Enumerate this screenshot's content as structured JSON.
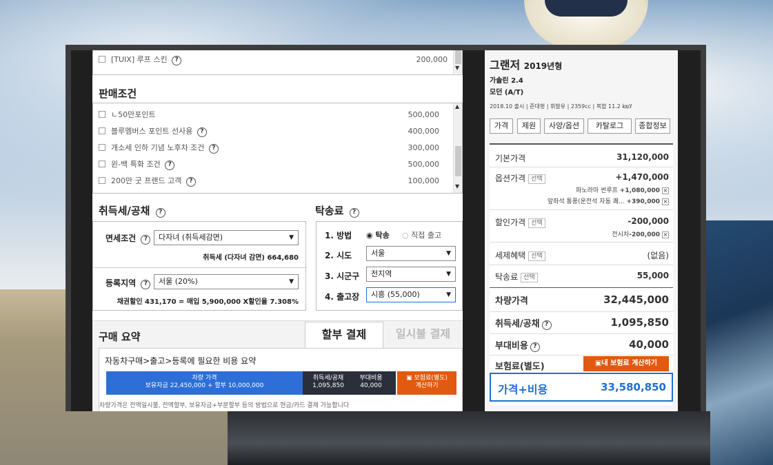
{
  "options_top": {
    "label": "[TUIX] 루프 스킨",
    "price": "200,000"
  },
  "sales": {
    "title": "판매조건",
    "items": [
      {
        "label": "ㄴ50만포인트",
        "price": "500,000",
        "q": false
      },
      {
        "label": "블루멤버스 포인트 선사용",
        "price": "400,000",
        "q": true
      },
      {
        "label": "개소세 인하 기념 노후차 조건",
        "price": "300,000",
        "q": true
      },
      {
        "label": "윈-백 특화 조건",
        "price": "500,000",
        "q": true
      },
      {
        "label": "200만 굿 프랜드 고객",
        "price": "100,000",
        "q": true
      }
    ]
  },
  "tax": {
    "title": "취득세/공채",
    "q": "?",
    "exempt_label": "면세조건",
    "exempt_value": "다자녀 (취득세감면)",
    "tax_text": "취득세 (다자녀 감면) 664,680",
    "region_label": "등록지역",
    "region_value": "서울 (20%)",
    "bond_text": "채권할인 431,170 = 매입 5,900,000 X할인율 7.308%"
  },
  "delivery": {
    "title": "탁송료",
    "q": "?",
    "method_label": "1. 방법",
    "method_opt1": "탁송",
    "method_opt2": "직접 출고",
    "sido_label": "2. 시도",
    "sido_value": "서울",
    "sigungu_label": "3. 시군구",
    "sigungu_value": "전지역",
    "depot_label": "4. 출고장",
    "depot_value": "시흥 (55,000)"
  },
  "summary": {
    "title": "구매 요약",
    "tab_installment": "할부 결제",
    "tab_lump": "일시불 결제",
    "subtitle": "자동차구매>출고>등록에 필요한 비용 요약",
    "car_price_label": "차량 가격",
    "car_price_detail": "보유자금 22,450,000 + 할부 10,000,000",
    "tax_label": "취득세/공채",
    "tax_value": "1,095,850",
    "extra_label": "부대비용",
    "extra_value": "40,000",
    "insurance_btn_line1": "보험료(별도)",
    "insurance_btn_line2": "계산하기",
    "footnote": "차량가격은 전액일시불, 전액할부, 보유자금+부분할부 등의 방법으로 현금/카드 결제 가능합니다"
  },
  "car": {
    "name": "그랜저",
    "year": "2019년형",
    "engine": "가솔린 2.4",
    "trim": "모던 (A/T)",
    "specs": "2018.10 출시 | 준대형 | 휘발유 | 2359cc | 복합 11.2 ㎞/ℓ",
    "tabs": [
      "가격",
      "제원",
      "사양/옵션",
      "카탈로그",
      "종합정보"
    ]
  },
  "pricing": {
    "base_label": "기본가격",
    "base_value": "31,120,000",
    "option_label": "옵션가격",
    "option_tag": "선택",
    "option_value": "+1,470,000",
    "option_items": [
      {
        "label": "파노라마 썬루프",
        "value": "+1,080,000"
      },
      {
        "label": "앞좌석 통풍(운전석 자동 쾌...",
        "value": "+390,000"
      }
    ],
    "discount_label": "할인가격",
    "discount_tag": "선택",
    "discount_value": "-200,000",
    "discount_item_label": "전시차",
    "discount_item_value": "-200,000",
    "taxbenefit_label": "세제혜택",
    "taxbenefit_tag": "선택",
    "taxbenefit_value": "(없음)",
    "delivery_label": "탁송료",
    "delivery_tag": "선택",
    "delivery_value": "55,000",
    "vehicle_label": "차량가격",
    "vehicle_value": "32,445,000",
    "acq_label": "취득세/공채",
    "acq_value": "1,095,850",
    "extra_label": "부대비용",
    "extra_value": "40,000",
    "ins_label": "보험료(별도)",
    "ins_btn": "내 보험료 계산하기",
    "total_label": "가격+비용",
    "total_value": "33,580,850"
  },
  "colors": {
    "accent_blue": "#1e6fd1",
    "orange": "#e05a10",
    "summary_blue": "#2d6fd6"
  }
}
